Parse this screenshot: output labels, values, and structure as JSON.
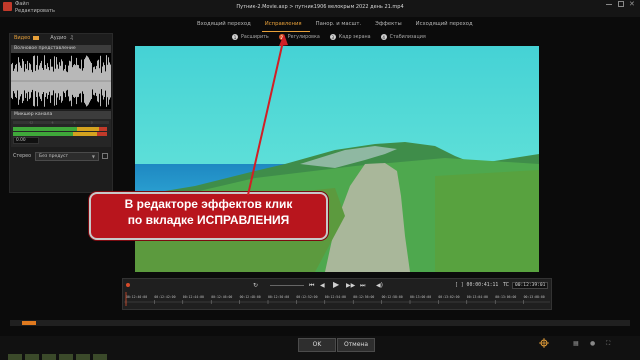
{
  "window": {
    "title": "Путник-2.Movie.axp  >  путник1906 велокрым 2022 день 21.mp4",
    "menu": [
      "Файл",
      "Редактировать"
    ]
  },
  "tabs": [
    {
      "label": "Входящий переход",
      "active": false
    },
    {
      "label": "Исправления",
      "active": true
    },
    {
      "label": "Панор. и масшт.",
      "active": false
    },
    {
      "label": "Эффекты",
      "active": false
    },
    {
      "label": "Исходящий переход",
      "active": false
    }
  ],
  "subtabs": [
    {
      "num": "1",
      "label": "Расширить",
      "active": false
    },
    {
      "num": "2",
      "label": "Регулировка",
      "active": true
    },
    {
      "num": "3",
      "label": "Кадр экрана",
      "active": false
    },
    {
      "num": "4",
      "label": "Стабилизация",
      "active": false
    }
  ],
  "left_panel": {
    "video_tab": "Видео",
    "audio_tab": "Аудио",
    "waveform_title": "Волновое представление",
    "mixer_title": "Микшер канала",
    "db_value": "0.00",
    "stereo_label": "Стерео",
    "preset_value": "Без предуст"
  },
  "callout": {
    "line1": "В редакторе эффектов клик",
    "line2": "по вкладке ИСПРАВЛЕНИЯ"
  },
  "transport": {
    "current_time": "[ ] 00:00:41:11",
    "tc_label": "TC",
    "total_time": "00:12:39:01",
    "ruler_ticks": [
      "00:12:40:00",
      "00:12:42:00",
      "00:12:44:00",
      "00:12:46:00",
      "00:12:48:00",
      "00:12:50:00",
      "00:12:52:00",
      "00:12:54:00",
      "00:12:56:00",
      "00:12:58:00",
      "00:13:00:00",
      "00:13:02:00",
      "00:13:04:00",
      "00:13:06:00",
      "00:13:08:00"
    ]
  },
  "buttons": {
    "ok": "OK",
    "cancel": "Отмена"
  },
  "colors": {
    "accent": "#e8a13a",
    "callout_bg": "#b8151d"
  }
}
